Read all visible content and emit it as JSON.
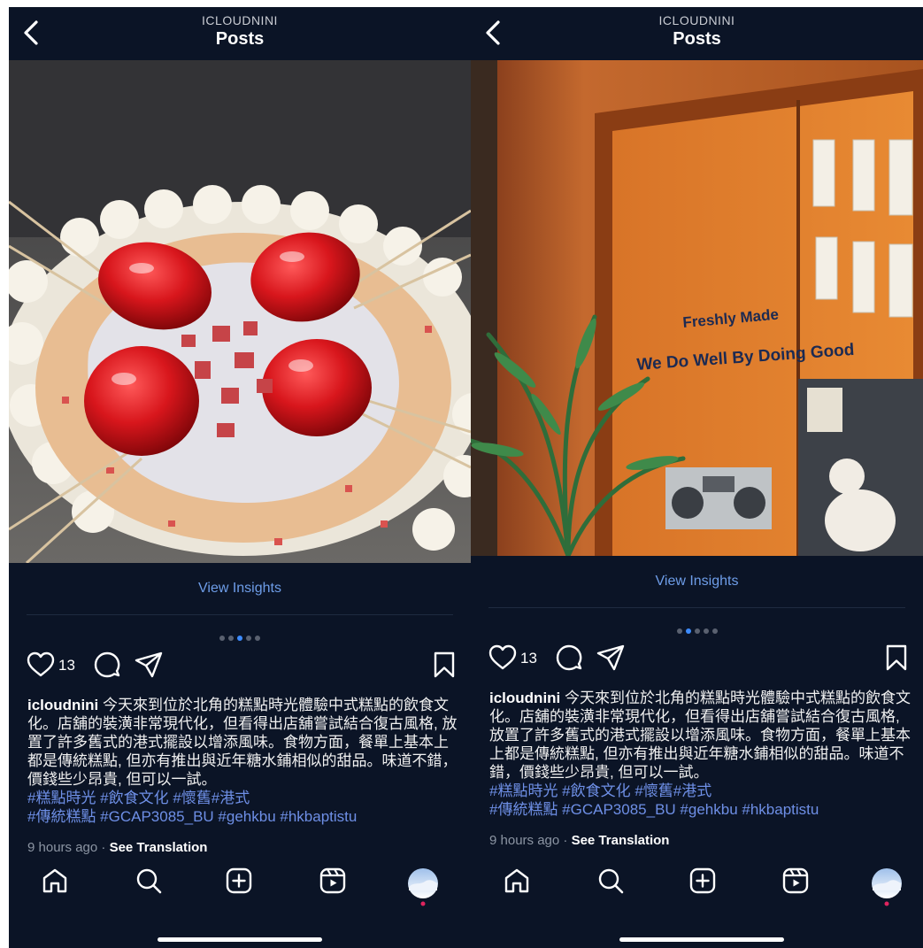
{
  "header": {
    "username": "ICLOUDNINI",
    "title": "Posts"
  },
  "post": {
    "view_insights": "View Insights",
    "likes": "13",
    "caption_user": "icloudnini",
    "caption_text": "今天來到位於北角的糕點時光體驗中式糕點的飲食文化。店舖的裝潢非常現代化，但看得出店舖嘗試結合復古風格, 放置了許多舊式的港式擺設以增添風味。食物方面，餐單上基本上都是傳統糕點, 但亦有推出與近年糖水鋪相似的甜品。味道不錯，價錢些少昂貴, 但可以一試。",
    "hashtags_line1": "#糕點時光 #飲食文化 #懷舊#港式",
    "hashtags_line2": "#傳統糕點 #GCAP3085_BU #gehkbu #hkbaptistu",
    "time": "9 hours ago",
    "separator": "·",
    "see_translation": "See Translation"
  },
  "carousel": {
    "left": {
      "count": 5,
      "active_index": 2
    },
    "right": {
      "count": 5,
      "active_index": 1
    }
  },
  "storefront_signs": {
    "freshly_made": "Freshly Made",
    "slogan": "We Do Well By Doing Good"
  },
  "icons": {
    "back": "chevron-left-icon",
    "like": "heart-icon",
    "comment": "comment-icon",
    "share": "share-icon",
    "save": "bookmark-icon",
    "home": "home-icon",
    "search": "search-icon",
    "create": "plus-square-icon",
    "reels": "reels-icon",
    "profile": "avatar"
  },
  "colors": {
    "background": "#0b1426",
    "link": "#6e9de8",
    "hashtag": "#6e8fe6",
    "dot_active": "#3d8bfd",
    "notification": "#e0245e"
  }
}
